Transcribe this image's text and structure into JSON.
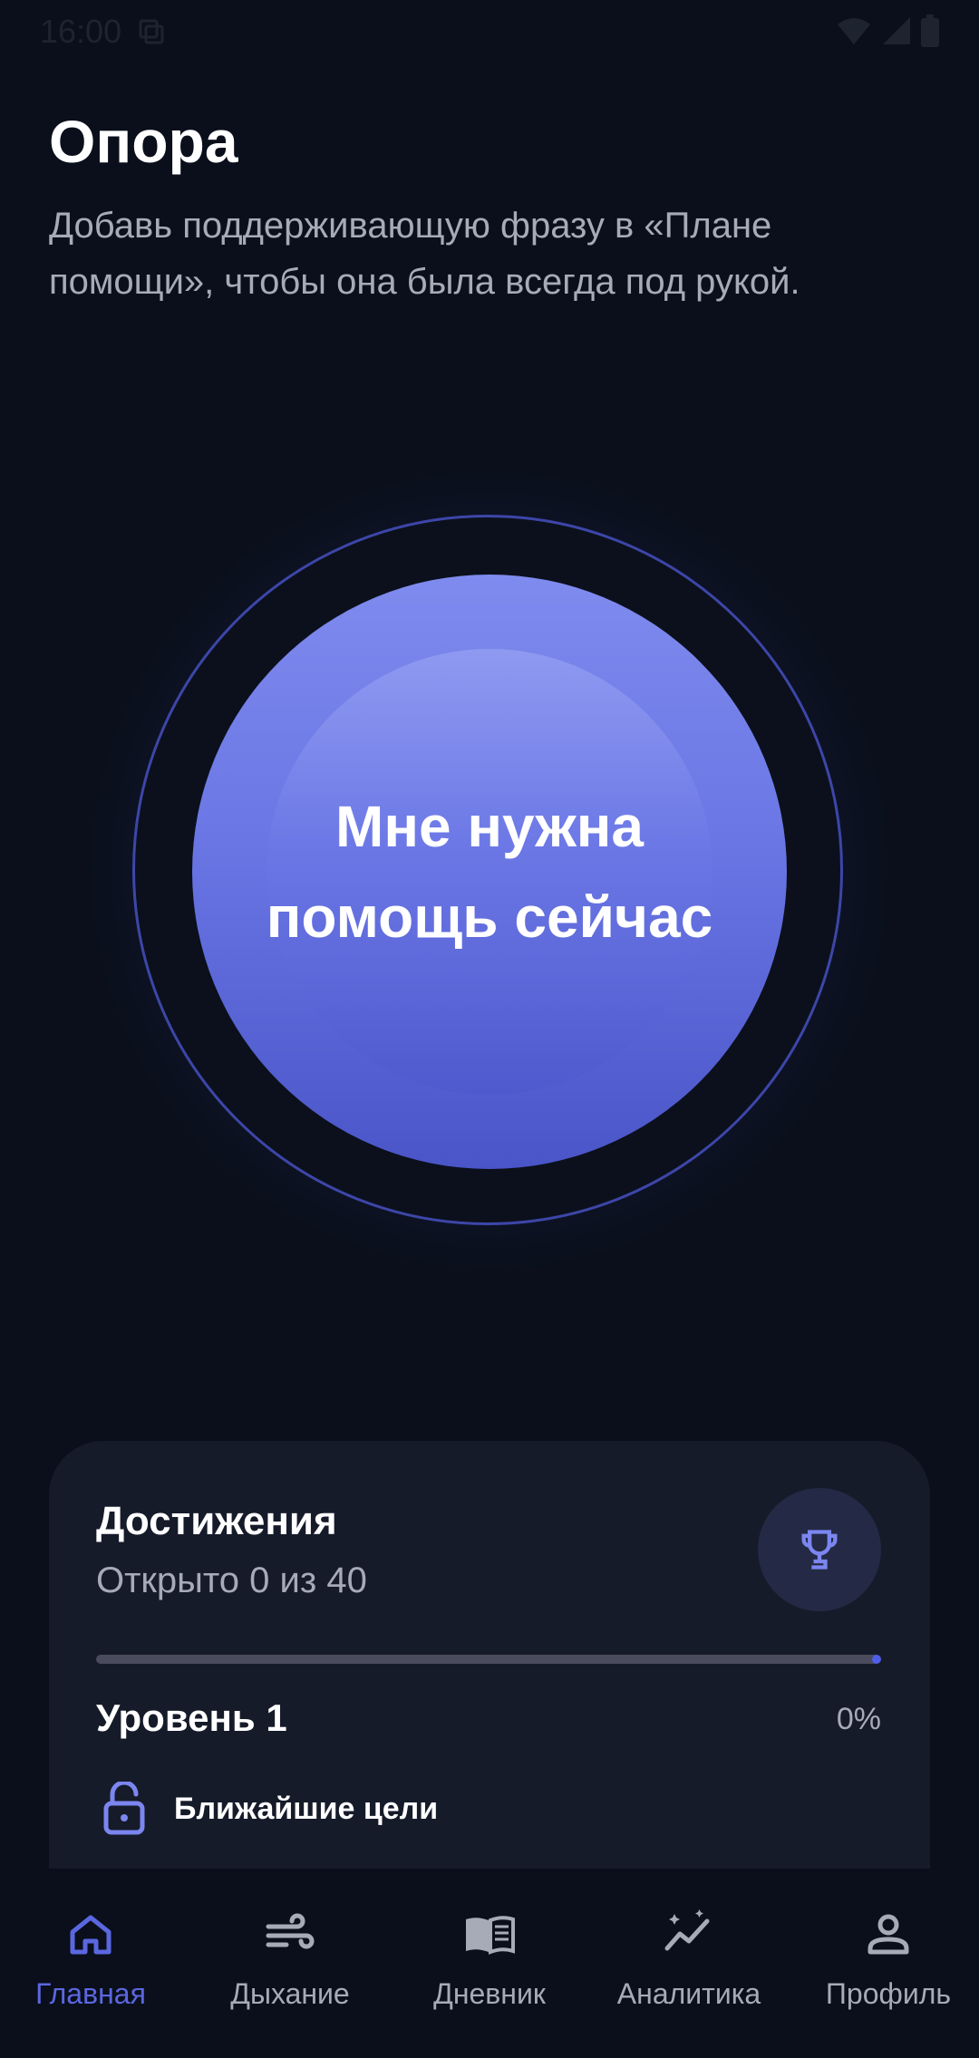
{
  "status_bar": {
    "time": "16:00"
  },
  "header": {
    "title": "Опора",
    "subtitle": "Добавь поддерживающую фразу в «Плане помощи», чтобы она была всегда под рукой."
  },
  "help_button": {
    "label": "Мне нужна помощь сейчас"
  },
  "achievements": {
    "title": "Достижения",
    "subtitle": "Открыто 0 из 40",
    "opened": 0,
    "total": 40,
    "level_label": "Уровень 1",
    "progress_percent": "0%",
    "progress_value": 0,
    "goals_label": "Ближайшие цели",
    "icon": "trophy-icon"
  },
  "nav": {
    "items": [
      {
        "label": "Главная",
        "icon": "home-icon",
        "active": true
      },
      {
        "label": "Дыхание",
        "icon": "wind-icon",
        "active": false
      },
      {
        "label": "Дневник",
        "icon": "book-icon",
        "active": false
      },
      {
        "label": "Аналитика",
        "icon": "analytics-icon",
        "active": false
      },
      {
        "label": "Профиль",
        "icon": "profile-icon",
        "active": false
      }
    ]
  },
  "colors": {
    "background": "#0a0f1b",
    "accent": "#5b67e0",
    "card": "#161b2a",
    "muted_text": "#a7abb8"
  }
}
